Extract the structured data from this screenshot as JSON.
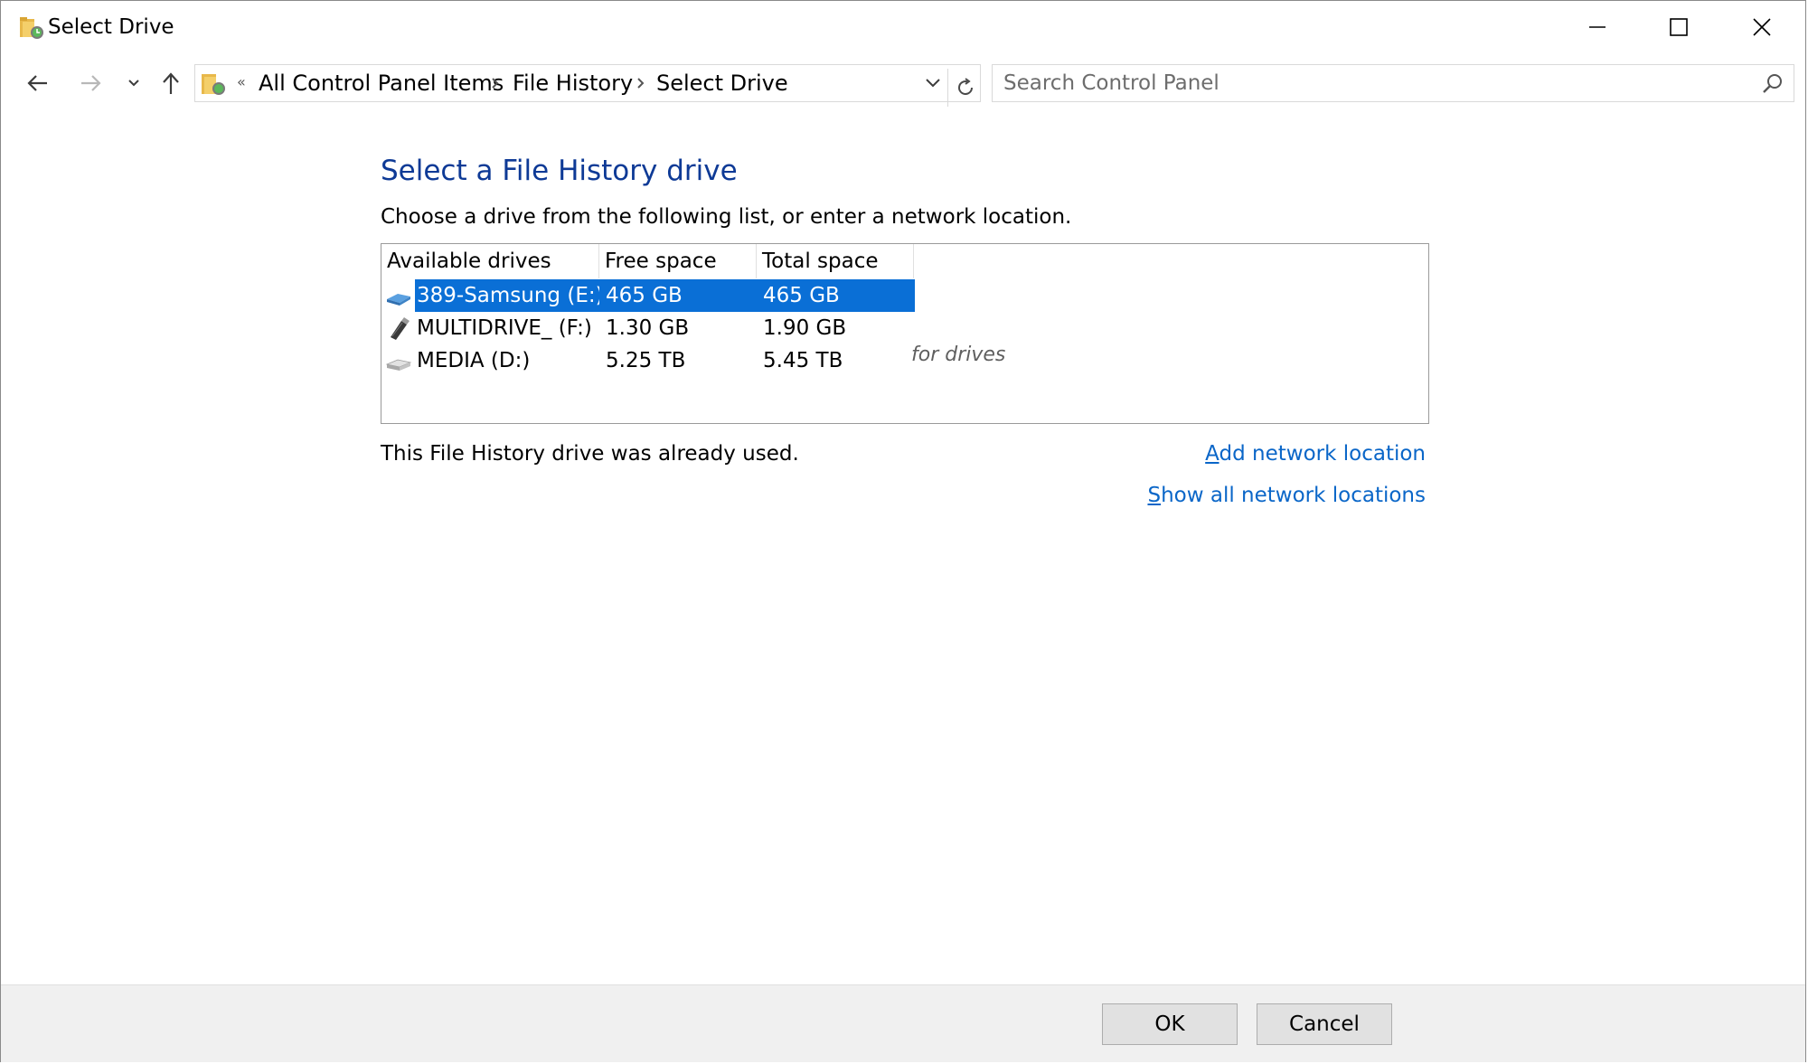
{
  "window": {
    "title": "Select Drive"
  },
  "navigation": {
    "breadcrumbs": [
      "All Control Panel Items",
      "File History",
      "Select Drive"
    ],
    "overflow_glyph": "«",
    "search_placeholder": "Search Control Panel"
  },
  "main": {
    "heading": "Select a File History drive",
    "instruction": "Choose a drive from the following list, or enter a network location.",
    "columns": [
      "Available drives",
      "Free space",
      "Total space"
    ],
    "drives": [
      {
        "name": "389-Samsung (E:)",
        "free": "465 GB",
        "total": "465 GB",
        "icon": "external-drive-icon",
        "selected": true
      },
      {
        "name": "MULTIDRIVE_ (F:)",
        "free": "1.30 GB",
        "total": "1.90 GB",
        "icon": "usb-drive-icon",
        "selected": false
      },
      {
        "name": "MEDIA (D:)",
        "free": "5.25 TB",
        "total": "5.45 TB",
        "icon": "hard-drive-icon",
        "selected": false
      }
    ],
    "hint": "for drives",
    "status": "This File History drive was already used.",
    "add_network_location": {
      "accel": "A",
      "rest": "dd network location"
    },
    "show_all_network_locations": {
      "accel": "S",
      "rest": "how all network locations"
    }
  },
  "footer": {
    "ok_label": "OK",
    "cancel_label": "Cancel"
  },
  "colors": {
    "heading": "#0e3a96",
    "link": "#0a66c8",
    "selection": "#0a6fd6"
  }
}
